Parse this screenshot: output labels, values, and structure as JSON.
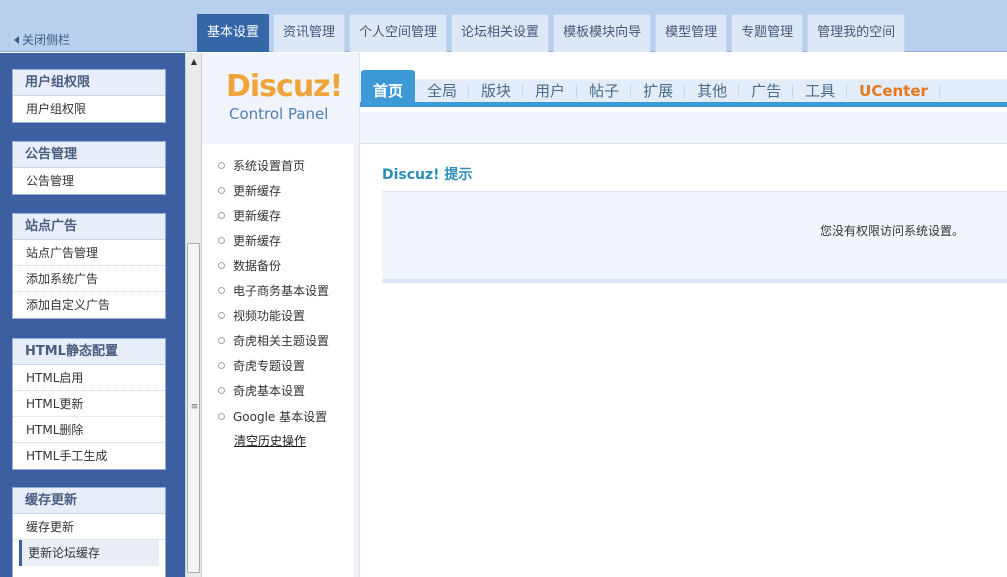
{
  "header": {
    "close_sidebar_label": "关闭侧栏",
    "top_tabs": [
      {
        "label": "基本设置",
        "active": true
      },
      {
        "label": "资讯管理"
      },
      {
        "label": "个人空间管理"
      },
      {
        "label": "论坛相关设置"
      },
      {
        "label": "模板模块向导"
      },
      {
        "label": "模型管理"
      },
      {
        "label": "专题管理"
      },
      {
        "label": "管理我的空间"
      }
    ]
  },
  "sidebar": {
    "groups": [
      {
        "title": "用户组权限",
        "items": [
          "用户组权限"
        ]
      },
      {
        "title": "公告管理",
        "items": [
          "公告管理"
        ]
      },
      {
        "title": "站点广告",
        "items": [
          "站点广告管理",
          "添加系统广告",
          "添加自定义广告"
        ]
      },
      {
        "title": "HTML静态配置",
        "items": [
          "HTML启用",
          "HTML更新",
          "HTML删除",
          "HTML手工生成"
        ]
      },
      {
        "title": "缓存更新",
        "items": [
          "缓存更新",
          "更新论坛缓存"
        ]
      }
    ]
  },
  "logo": {
    "brand": "Discuz!",
    "subtitle": "Control Panel"
  },
  "main_nav": {
    "tabs": [
      "首页",
      "全局",
      "版块",
      "用户",
      "帖子",
      "扩展",
      "其他",
      "广告",
      "工具",
      "UCenter"
    ],
    "active_index": 0
  },
  "submenu": {
    "items": [
      "系统设置首页",
      "更新缓存",
      "更新缓存",
      "更新缓存",
      "数据备份",
      "电子商务基本设置",
      "视频功能设置",
      "奇虎相关主题设置",
      "奇虎专题设置",
      "奇虎基本设置",
      "Google 基本设置"
    ],
    "clear_history": "清空历史操作"
  },
  "notice": {
    "title": "Discuz! 提示",
    "message": "您没有权限访问系统设置。"
  },
  "colors": {
    "sidebar_bg": "#3b5fa0",
    "active_tab": "#3466a8",
    "main_nav_accent": "#3d9ad6",
    "ucenter": "#e6771b",
    "logo": "#f0a43a"
  }
}
